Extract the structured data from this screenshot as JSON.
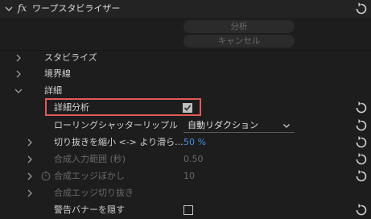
{
  "effect": {
    "fx_label": "fx",
    "name": "ワープスタビライザー"
  },
  "buttons": {
    "analyze": "分析",
    "cancel": "キャンセル"
  },
  "groups": {
    "stabilize": "スタビライズ",
    "borders": "境界線",
    "advanced": "詳細"
  },
  "params": {
    "detailed_analysis": {
      "label": "詳細分析",
      "checked": true
    },
    "rolling_shutter": {
      "label": "ローリングシャッターリップル",
      "value": "自動リダクション"
    },
    "crop_less_smooth": {
      "label": "切り抜きを縮小 <-> より滑ら...",
      "value": "50 %"
    },
    "synth_input_range": {
      "label": "合成入力範囲 (秒)",
      "value": "0.50"
    },
    "synth_edge_feather": {
      "label": "合成エッジぼかし",
      "value": "10"
    },
    "synth_edge_cropping": {
      "label": "合成エッジ切り抜き"
    },
    "hide_warning_banner": {
      "label": "警告バナーを隠す",
      "checked": false
    }
  },
  "colors": {
    "highlight": "#e05a57",
    "value_blue": "#3f8fe6"
  }
}
